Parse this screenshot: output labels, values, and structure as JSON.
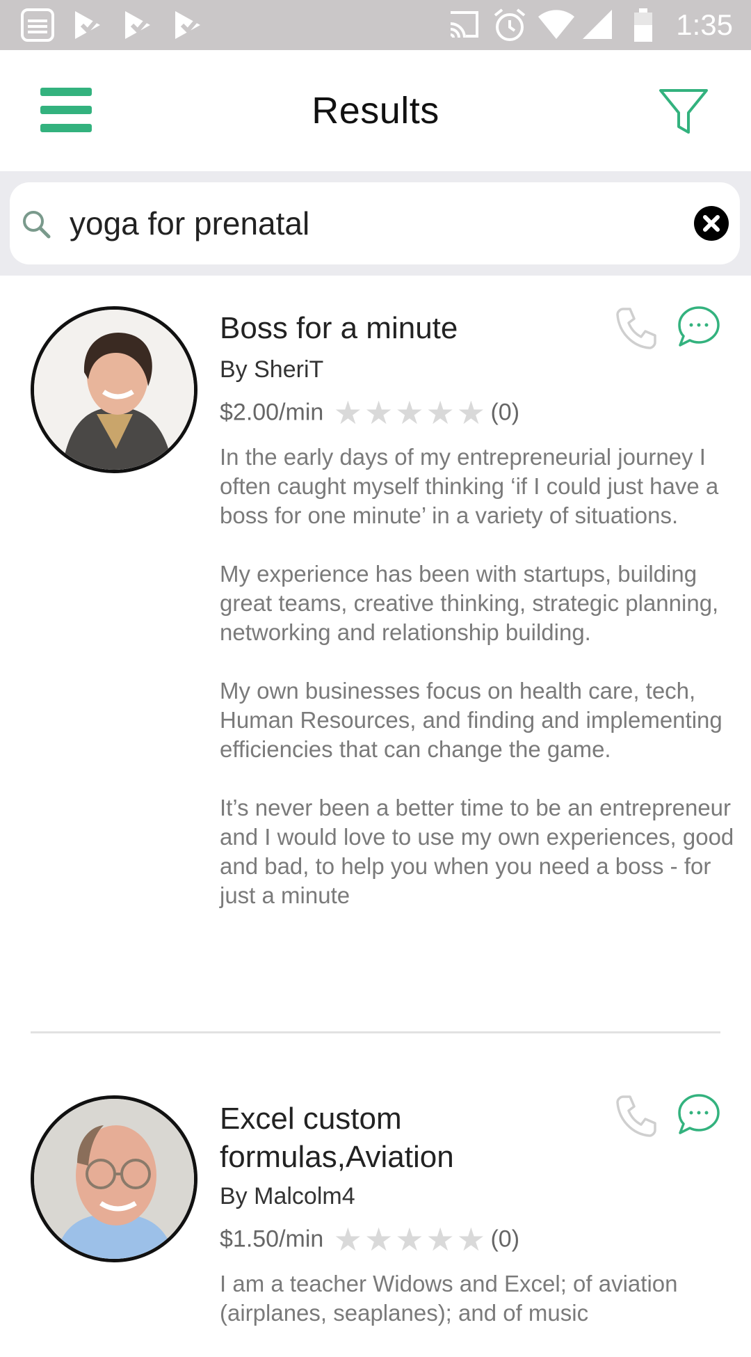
{
  "status_bar": {
    "time": "1:35"
  },
  "header": {
    "title": "Results"
  },
  "search": {
    "value": "yoga for prenatal"
  },
  "results": [
    {
      "title": "Boss for a minute",
      "by": "By SheriT",
      "price": "$2.00/min",
      "rating_stars": 0,
      "review_count": "(0)",
      "description": [
        "In the early days of my entrepreneurial journey I often caught myself thinking ‘if I could just have a boss for one minute’ in a variety of situations.",
        "My experience has been with startups, building great teams, creative thinking, strategic planning, networking and relationship building.",
        "My own businesses focus on health care, tech, Human Resources, and finding and implementing efficiencies that can change the game.",
        "It’s never been a better time to be an entrepreneur and I would love to use my own experiences, good and bad, to help you when you need a boss - for just a minute"
      ]
    },
    {
      "title": "Excel custom formulas,Aviation",
      "by": "By Malcolm4",
      "price": "$1.50/min",
      "rating_stars": 0,
      "review_count": "(0)",
      "description": [
        "I am a teacher Widows and Excel; of aviation (airplanes, seaplanes); and of music"
      ]
    }
  ],
  "colors": {
    "accent": "#33b27e",
    "status_bar": "#cac7c8",
    "search_bg": "#ebebef",
    "text_muted": "#7a7a7a",
    "star_empty": "#d9d9d9"
  },
  "icons": [
    "notification-icon",
    "check-icon",
    "cast-icon",
    "alarm-icon",
    "wifi-icon",
    "signal-icon",
    "battery-icon",
    "menu-icon",
    "filter-icon",
    "search-icon",
    "clear-icon",
    "phone-icon",
    "chat-icon",
    "star-icon"
  ]
}
